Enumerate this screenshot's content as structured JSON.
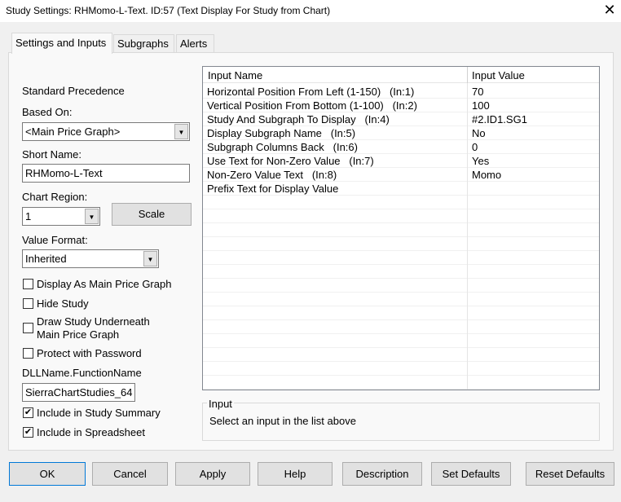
{
  "window": {
    "title": "Study Settings: RHMomo-L-Text. ID:57 (Text Display For Study from Chart)",
    "close": "✕"
  },
  "tabs": [
    {
      "label": "Settings and Inputs"
    },
    {
      "label": "Subgraphs"
    },
    {
      "label": "Alerts"
    }
  ],
  "left": {
    "standard_precedence": "Standard Precedence",
    "based_on_label": "Based On:",
    "based_on_value": "<Main Price Graph>",
    "short_name_label": "Short Name:",
    "short_name_value": "RHMomo-L-Text",
    "chart_region_label": "Chart Region:",
    "chart_region_value": "1",
    "scale_button": "Scale",
    "value_format_label": "Value Format:",
    "value_format_value": "Inherited",
    "checkboxes": [
      {
        "label": "Display As Main Price Graph",
        "checked": false
      },
      {
        "label": "Hide Study",
        "checked": false
      },
      {
        "label": "Draw Study Underneath",
        "label2": "Main Price Graph",
        "checked": false
      },
      {
        "label": "Protect with Password",
        "checked": false
      }
    ],
    "dll_label": "DLLName.FunctionName",
    "dll_value": "SierraChartStudies_64",
    "checkboxes2": [
      {
        "label": "Include in Study Summary",
        "checked": true
      },
      {
        "label": "Include in Spreadsheet",
        "checked": true
      }
    ]
  },
  "inputs_table": {
    "headers": [
      "Input Name",
      "Input Value"
    ],
    "rows": [
      {
        "name": "Horizontal Position From Left (1-150)   (In:1)",
        "value": "70"
      },
      {
        "name": "Vertical Position From Bottom (1-100)   (In:2)",
        "value": "100"
      },
      {
        "name": "Study And Subgraph To Display   (In:4)",
        "value": "#2.ID1.SG1"
      },
      {
        "name": "Display Subgraph Name   (In:5)",
        "value": "No"
      },
      {
        "name": "Subgraph Columns Back   (In:6)",
        "value": "0"
      },
      {
        "name": "Use Text for Non-Zero Value   (In:7)",
        "value": "Yes"
      },
      {
        "name": "Non-Zero Value Text   (In:8)",
        "value": "Momo"
      },
      {
        "name": "Prefix Text for Display Value",
        "value": ""
      }
    ]
  },
  "input_group": {
    "title": "Input",
    "text": "Select an input in the list above"
  },
  "buttons": [
    "OK",
    "Cancel",
    "Apply",
    "Help",
    "Description",
    "Set Defaults",
    "Reset Defaults"
  ]
}
